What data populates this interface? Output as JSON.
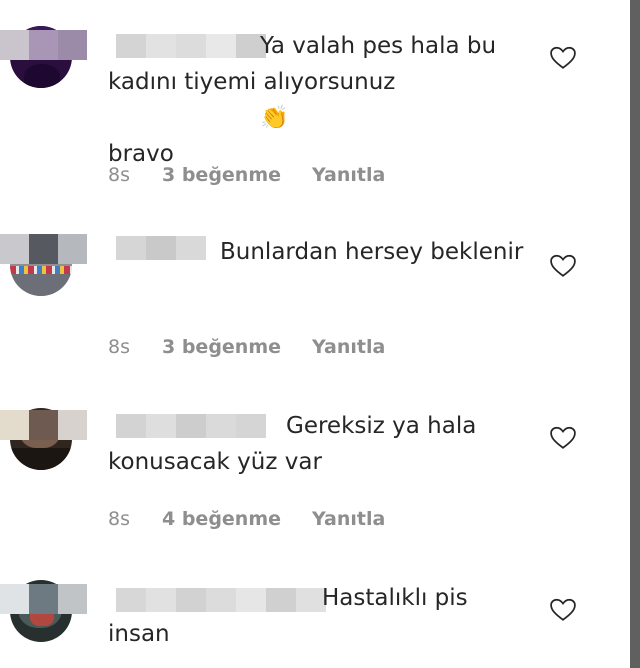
{
  "comments": [
    {
      "text": "Ya valah pes hala bu kadını tiyemi alıyorsunuz",
      "emoji": "👏",
      "emoji_extra": "bravo",
      "time": "8s",
      "likes": "3 beğenme",
      "reply": "Yanıtla",
      "icon": "heart-outline-icon"
    },
    {
      "text": "Bunlardan hersey beklenir",
      "time": "8s",
      "likes": "3 beğenme",
      "reply": "Yanıtla",
      "icon": "heart-outline-icon"
    },
    {
      "text": "Gereksiz ya hala konusacak yüz var",
      "time": "8s",
      "likes": "4 beğenme",
      "reply": "Yanıtla",
      "icon": "heart-outline-icon"
    },
    {
      "text": "Hastalıklı pis insan",
      "icon": "heart-outline-icon"
    }
  ]
}
